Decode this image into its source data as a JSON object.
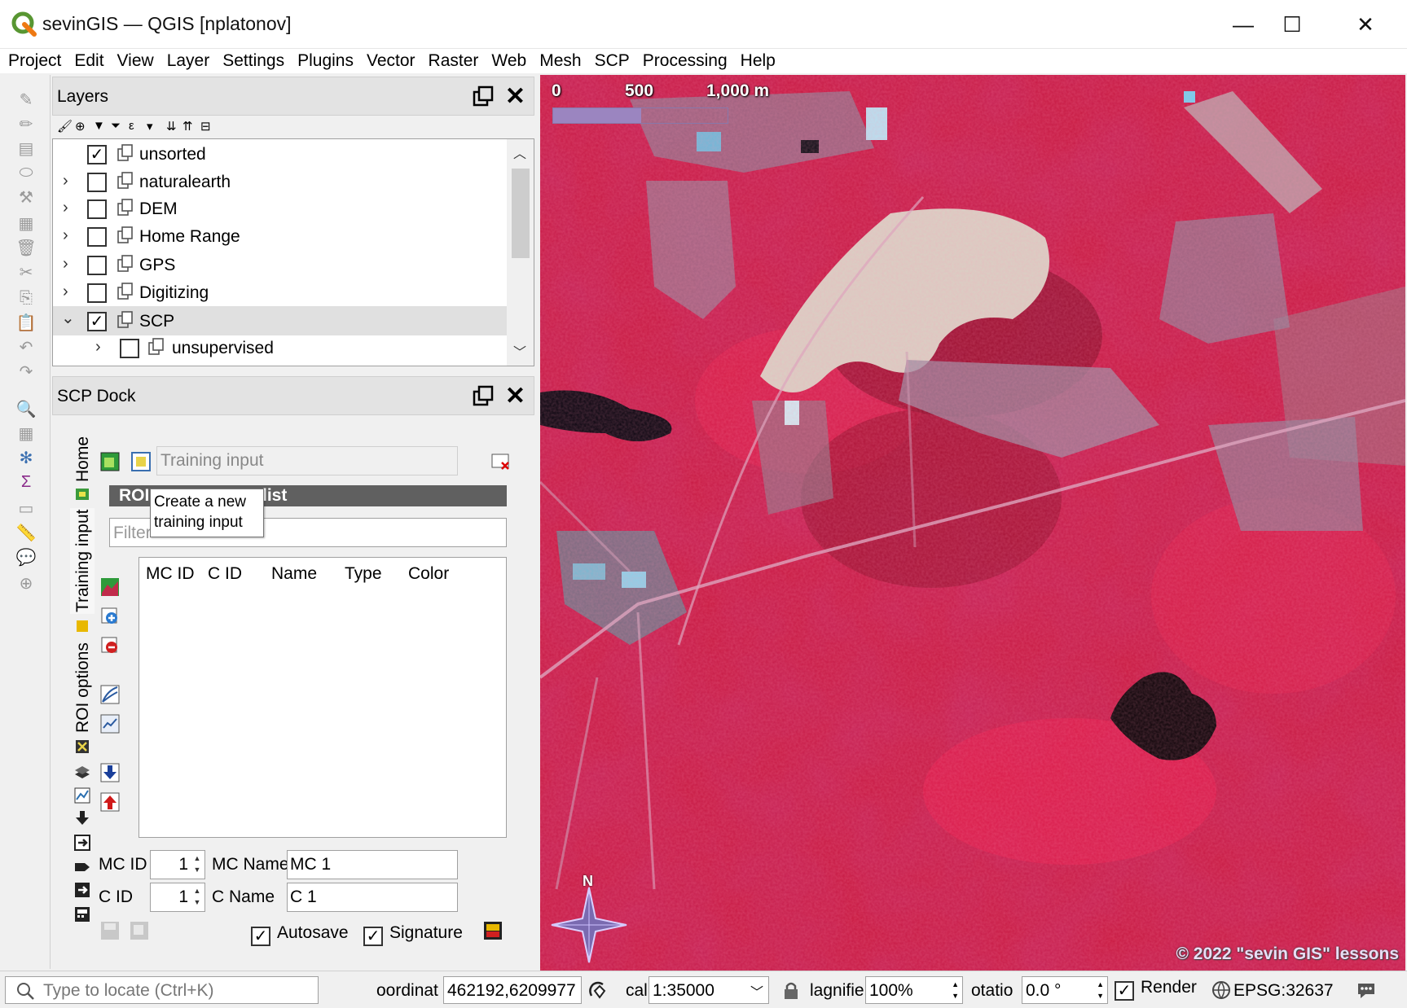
{
  "window": {
    "title": "sevinGIS — QGIS [nplatonov]",
    "controls": {
      "minimize": "—",
      "maximize": "☐",
      "close": "✕"
    }
  },
  "menu": [
    "Project",
    "Edit",
    "View",
    "Layer",
    "Settings",
    "Plugins",
    "Vector",
    "Raster",
    "Web",
    "Mesh",
    "SCP",
    "Processing",
    "Help"
  ],
  "layers_panel": {
    "title": "Layers",
    "items": [
      {
        "name": "unsorted",
        "checked": true,
        "expander": ""
      },
      {
        "name": "naturalearth",
        "checked": false,
        "expander": "›"
      },
      {
        "name": "DEM",
        "checked": false,
        "expander": "›"
      },
      {
        "name": "Home Range",
        "checked": false,
        "expander": "›"
      },
      {
        "name": "GPS",
        "checked": false,
        "expander": "›"
      },
      {
        "name": "Digitizing",
        "checked": false,
        "expander": "›"
      },
      {
        "name": "SCP",
        "checked": true,
        "expander": "⌄"
      },
      {
        "name": "unsupervised",
        "checked": false,
        "expander": "›"
      }
    ]
  },
  "scp_dock": {
    "title": "SCP Dock",
    "tabs": [
      "Home",
      "Training input",
      "ROI options"
    ],
    "training_input_placeholder": "Training input",
    "roi_header_left": "ROI",
    "roi_header_right": "list",
    "tooltip": "Create a new training input",
    "filter_placeholder": "Filter",
    "columns": [
      "MC ID",
      "C ID",
      "Name",
      "Type",
      "Color"
    ],
    "mc_id_label": "MC ID",
    "mc_id_value": "1",
    "mc_name_label": "MC Name",
    "mc_name_value": "MC 1",
    "c_id_label": "C ID",
    "c_id_value": "1",
    "c_name_label": "C Name",
    "c_name_value": "C 1",
    "autosave_label": "Autosave",
    "autosave_checked": true,
    "signature_label": "Signature",
    "signature_checked": true
  },
  "map": {
    "scalebar_labels": [
      "0",
      "500",
      "1,000 m"
    ],
    "north_label": "N",
    "copyright": "© 2022 \"sevin GIS\" lessons"
  },
  "statusbar": {
    "locator_placeholder": "Type to locate (Ctrl+K)",
    "coordinate_label": "oordinat",
    "coordinate_value": "462192,6209977",
    "scale_label": "cal",
    "scale_value": "1:35000",
    "magnifier_label": "lagnifie",
    "magnifier_value": "100%",
    "rotation_label": "otatio",
    "rotation_value": "0.0 °",
    "render_label": "Render",
    "render_checked": true,
    "crs": "EPSG:32637"
  },
  "colors": {
    "map_base": "#c01436",
    "scalebar_fill": "#9b85c0",
    "roi_header": "#606060"
  }
}
